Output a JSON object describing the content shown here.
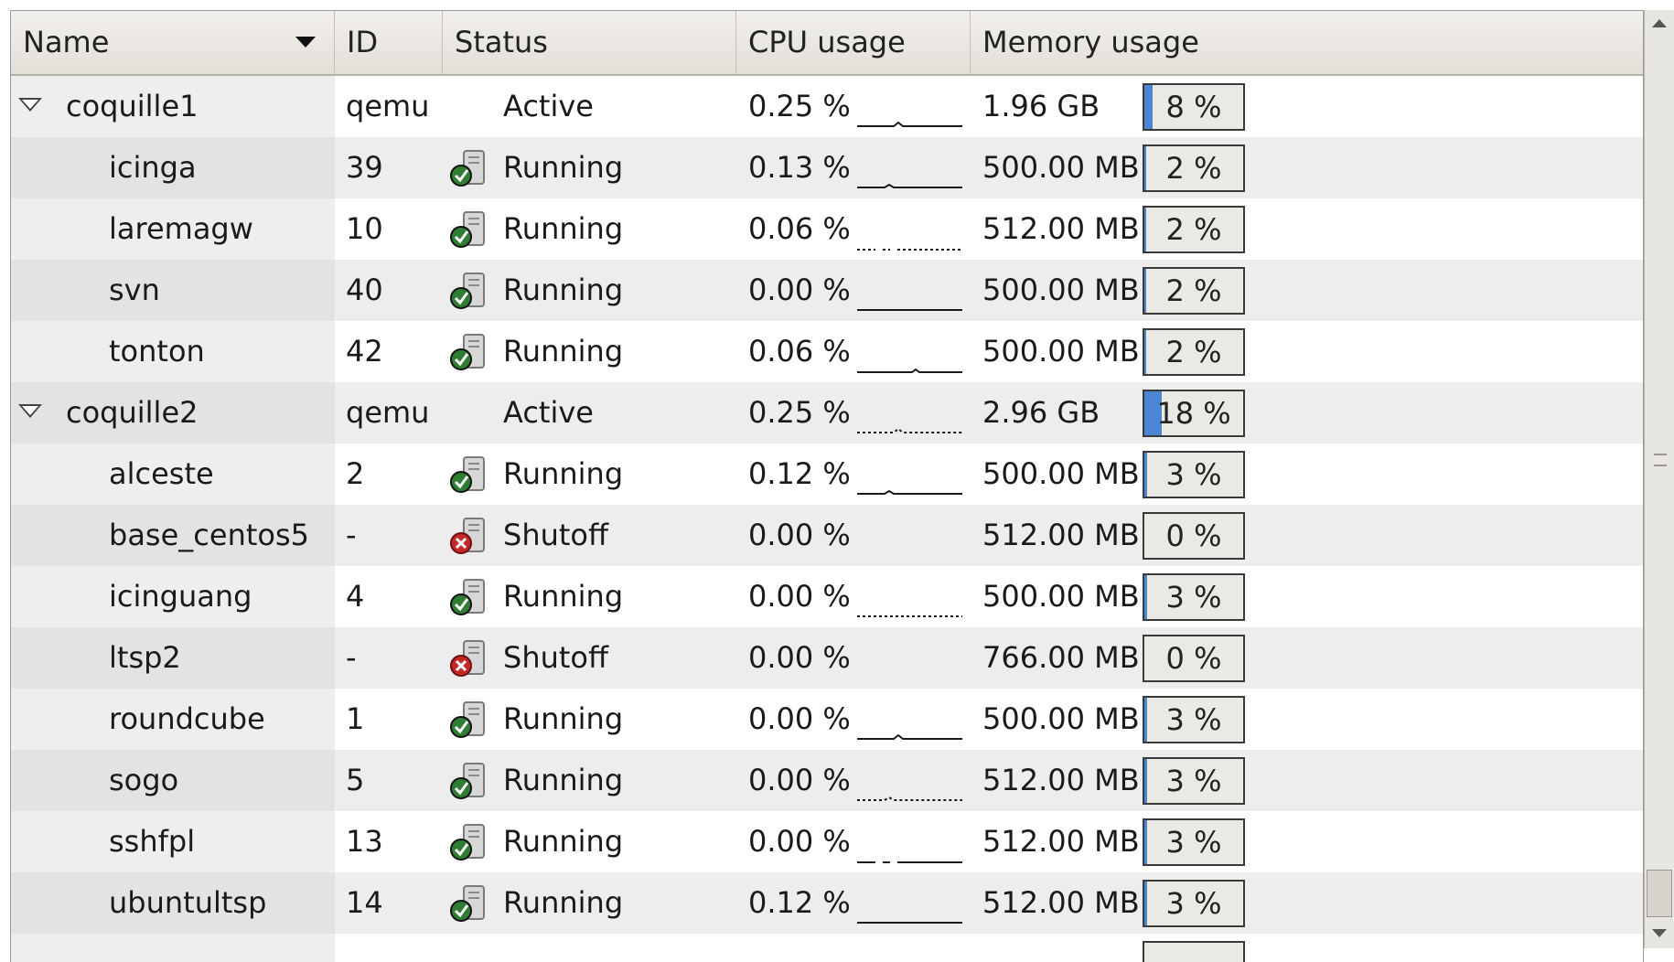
{
  "columns": [
    {
      "label": "Name"
    },
    {
      "label": "ID"
    },
    {
      "label": "Status"
    },
    {
      "label": "CPU usage"
    },
    {
      "label": "Memory usage"
    }
  ],
  "sort": {
    "column": "Name",
    "direction": "descending"
  },
  "colors": {
    "memory_fill": "#4a86d4",
    "running_badge": "#2e7d32",
    "shutoff_badge": "#c62828"
  },
  "rows": [
    {
      "type": "host",
      "name": "coquille1",
      "id": "qemu",
      "status": "Active",
      "cpu": "0.25 %",
      "memory": "1.96 GB",
      "mem_pct": "8 %",
      "mem_fraction": 0.08,
      "expanded": true,
      "icon": "none"
    },
    {
      "type": "vm",
      "name": "icinga",
      "id": "39",
      "status": "Running",
      "cpu": "0.13 %",
      "memory": "500.00 MB",
      "mem_pct": "2 %",
      "mem_fraction": 0.02,
      "icon": "running-icon"
    },
    {
      "type": "vm",
      "name": "laremagw",
      "id": "10",
      "status": "Running",
      "cpu": "0.06 %",
      "memory": "512.00 MB",
      "mem_pct": "2 %",
      "mem_fraction": 0.02,
      "icon": "running-icon"
    },
    {
      "type": "vm",
      "name": "svn",
      "id": "40",
      "status": "Running",
      "cpu": "0.00 %",
      "memory": "500.00 MB",
      "mem_pct": "2 %",
      "mem_fraction": 0.02,
      "icon": "running-icon"
    },
    {
      "type": "vm",
      "name": "tonton",
      "id": "42",
      "status": "Running",
      "cpu": "0.06 %",
      "memory": "500.00 MB",
      "mem_pct": "2 %",
      "mem_fraction": 0.02,
      "icon": "running-icon"
    },
    {
      "type": "host",
      "name": "coquille2",
      "id": "qemu",
      "status": "Active",
      "cpu": "0.25 %",
      "memory": "2.96 GB",
      "mem_pct": "18 %",
      "mem_fraction": 0.18,
      "expanded": true,
      "icon": "none"
    },
    {
      "type": "vm",
      "name": "alceste",
      "id": "2",
      "status": "Running",
      "cpu": "0.12 %",
      "memory": "500.00 MB",
      "mem_pct": "3 %",
      "mem_fraction": 0.03,
      "icon": "running-icon"
    },
    {
      "type": "vm",
      "name": "base_centos5",
      "id": "-",
      "status": "Shutoff",
      "cpu": "0.00 %",
      "memory": "512.00 MB",
      "mem_pct": "0 %",
      "mem_fraction": 0.0,
      "icon": "shutoff-icon"
    },
    {
      "type": "vm",
      "name": "icinguang",
      "id": "4",
      "status": "Running",
      "cpu": "0.00 %",
      "memory": "500.00 MB",
      "mem_pct": "3 %",
      "mem_fraction": 0.03,
      "icon": "running-icon"
    },
    {
      "type": "vm",
      "name": "ltsp2",
      "id": "-",
      "status": "Shutoff",
      "cpu": "0.00 %",
      "memory": "766.00 MB",
      "mem_pct": "0 %",
      "mem_fraction": 0.0,
      "icon": "shutoff-icon"
    },
    {
      "type": "vm",
      "name": "roundcube",
      "id": "1",
      "status": "Running",
      "cpu": "0.00 %",
      "memory": "500.00 MB",
      "mem_pct": "3 %",
      "mem_fraction": 0.03,
      "icon": "running-icon"
    },
    {
      "type": "vm",
      "name": "sogo",
      "id": "5",
      "status": "Running",
      "cpu": "0.00 %",
      "memory": "512.00 MB",
      "mem_pct": "3 %",
      "mem_fraction": 0.03,
      "icon": "running-icon"
    },
    {
      "type": "vm",
      "name": "sshfpl",
      "id": "13",
      "status": "Running",
      "cpu": "0.00 %",
      "memory": "512.00 MB",
      "mem_pct": "3 %",
      "mem_fraction": 0.03,
      "icon": "running-icon"
    },
    {
      "type": "vm",
      "name": "ubuntultsp",
      "id": "14",
      "status": "Running",
      "cpu": "0.12 %",
      "memory": "512.00 MB",
      "mem_pct": "3 %",
      "mem_fraction": 0.03,
      "icon": "running-icon"
    }
  ]
}
